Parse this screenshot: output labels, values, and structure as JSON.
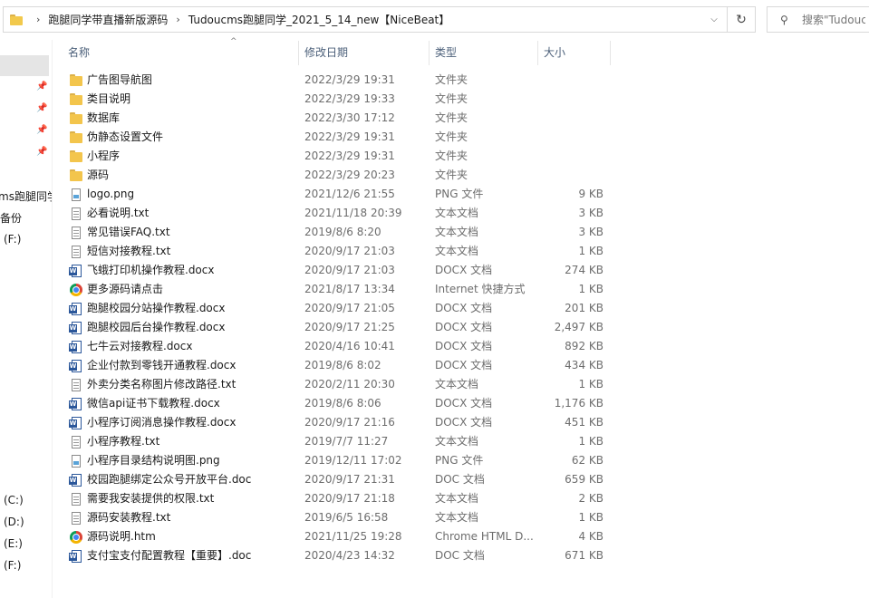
{
  "address_bar": {
    "breadcrumbs": [
      "跑腿同学带直播新版源码",
      "Tudoucms跑腿同学_2021_5_14_new【NiceBeat】"
    ]
  },
  "search": {
    "placeholder": "搜索\"Tudouc"
  },
  "columns": {
    "name": "名称",
    "date": "修改日期",
    "type": "类型",
    "size": "大小"
  },
  "nav_pane": {
    "items": [
      "ms跑腿同学",
      "备份",
      "(F:)",
      "(C:)",
      "(D:)",
      "(E:)",
      "(F:)"
    ]
  },
  "icons": {
    "folder": "folder-icon",
    "txt": "text-document-icon",
    "png": "image-file-icon",
    "docx": "word-document-icon",
    "url": "chrome-icon",
    "htm": "chrome-icon"
  },
  "files": [
    {
      "name": "广告图导航图",
      "date": "2022/3/29 19:31",
      "type": "文件夹",
      "size": "",
      "icon": "folder"
    },
    {
      "name": "类目说明",
      "date": "2022/3/29 19:33",
      "type": "文件夹",
      "size": "",
      "icon": "folder"
    },
    {
      "name": "数据库",
      "date": "2022/3/30 17:12",
      "type": "文件夹",
      "size": "",
      "icon": "folder"
    },
    {
      "name": "伪静态设置文件",
      "date": "2022/3/29 19:31",
      "type": "文件夹",
      "size": "",
      "icon": "folder"
    },
    {
      "name": "小程序",
      "date": "2022/3/29 19:31",
      "type": "文件夹",
      "size": "",
      "icon": "folder"
    },
    {
      "name": "源码",
      "date": "2022/3/29 20:23",
      "type": "文件夹",
      "size": "",
      "icon": "folder"
    },
    {
      "name": "logo.png",
      "date": "2021/12/6 21:55",
      "type": "PNG 文件",
      "size": "9 KB",
      "icon": "png"
    },
    {
      "name": "必看说明.txt",
      "date": "2021/11/18 20:39",
      "type": "文本文档",
      "size": "3 KB",
      "icon": "txt"
    },
    {
      "name": "常见错误FAQ.txt",
      "date": "2019/8/6 8:20",
      "type": "文本文档",
      "size": "3 KB",
      "icon": "txt"
    },
    {
      "name": "短信对接教程.txt",
      "date": "2020/9/17 21:03",
      "type": "文本文档",
      "size": "1 KB",
      "icon": "txt"
    },
    {
      "name": "飞蛾打印机操作教程.docx",
      "date": "2020/9/17 21:03",
      "type": "DOCX 文档",
      "size": "274 KB",
      "icon": "docx"
    },
    {
      "name": "更多源码请点击",
      "date": "2021/8/17 13:34",
      "type": "Internet 快捷方式",
      "size": "1 KB",
      "icon": "url"
    },
    {
      "name": "跑腿校园分站操作教程.docx",
      "date": "2020/9/17 21:05",
      "type": "DOCX 文档",
      "size": "201 KB",
      "icon": "docx"
    },
    {
      "name": "跑腿校园后台操作教程.docx",
      "date": "2020/9/17 21:25",
      "type": "DOCX 文档",
      "size": "2,497 KB",
      "icon": "docx"
    },
    {
      "name": "七牛云对接教程.docx",
      "date": "2020/4/16 10:41",
      "type": "DOCX 文档",
      "size": "892 KB",
      "icon": "docx"
    },
    {
      "name": "企业付款到零钱开通教程.docx",
      "date": "2019/8/6 8:02",
      "type": "DOCX 文档",
      "size": "434 KB",
      "icon": "docx"
    },
    {
      "name": "外卖分类名称图片修改路径.txt",
      "date": "2020/2/11 20:30",
      "type": "文本文档",
      "size": "1 KB",
      "icon": "txt"
    },
    {
      "name": "微信api证书下载教程.docx",
      "date": "2019/8/6 8:06",
      "type": "DOCX 文档",
      "size": "1,176 KB",
      "icon": "docx"
    },
    {
      "name": "小程序订阅消息操作教程.docx",
      "date": "2020/9/17 21:16",
      "type": "DOCX 文档",
      "size": "451 KB",
      "icon": "docx"
    },
    {
      "name": "小程序教程.txt",
      "date": "2019/7/7 11:27",
      "type": "文本文档",
      "size": "1 KB",
      "icon": "txt"
    },
    {
      "name": "小程序目录结构说明图.png",
      "date": "2019/12/11 17:02",
      "type": "PNG 文件",
      "size": "62 KB",
      "icon": "png"
    },
    {
      "name": "校园跑腿绑定公众号开放平台.doc",
      "date": "2020/9/17 21:31",
      "type": "DOC 文档",
      "size": "659 KB",
      "icon": "docx"
    },
    {
      "name": "需要我安装提供的权限.txt",
      "date": "2020/9/17 21:18",
      "type": "文本文档",
      "size": "2 KB",
      "icon": "txt"
    },
    {
      "name": "源码安装教程.txt",
      "date": "2019/6/5 16:58",
      "type": "文本文档",
      "size": "1 KB",
      "icon": "txt"
    },
    {
      "name": "源码说明.htm",
      "date": "2021/11/25 19:28",
      "type": "Chrome HTML D...",
      "size": "4 KB",
      "icon": "htm"
    },
    {
      "name": "支付宝支付配置教程【重要】.doc",
      "date": "2020/4/23 14:32",
      "type": "DOC 文档",
      "size": "671 KB",
      "icon": "docx"
    }
  ]
}
